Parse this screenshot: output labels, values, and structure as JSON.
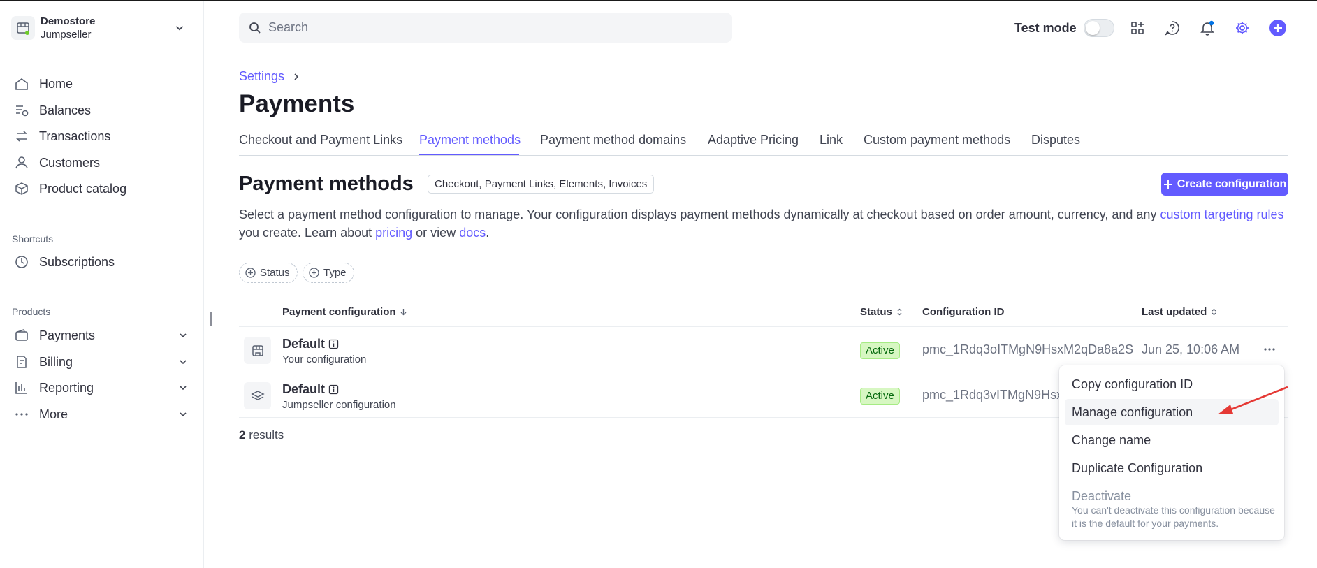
{
  "account": {
    "name": "Demostore",
    "sub": "Jumpseller"
  },
  "nav": {
    "main": [
      "Home",
      "Balances",
      "Transactions",
      "Customers",
      "Product catalog"
    ],
    "shortcuts_label": "Shortcuts",
    "shortcuts": [
      "Subscriptions"
    ],
    "products_label": "Products",
    "products": [
      "Payments",
      "Billing",
      "Reporting",
      "More"
    ]
  },
  "search": {
    "placeholder": "Search"
  },
  "topbar": {
    "test_mode_label": "Test mode",
    "test_mode_on": false
  },
  "breadcrumb": "Settings",
  "page_title": "Payments",
  "tabs": [
    "Checkout and Payment Links",
    "Payment methods",
    "Payment method domains",
    "Adaptive Pricing",
    "Link",
    "Custom payment methods",
    "Disputes"
  ],
  "active_tab": "Payment methods",
  "section": {
    "title": "Payment methods",
    "tag": "Checkout, Payment Links, Elements, Invoices",
    "create_button": "Create configuration",
    "desc_1": "Select a payment method configuration to manage. Your configuration displays payment methods dynamically at checkout based on order amount, currency, and any ",
    "desc_link_1": "custom targeting rules",
    "desc_2": " you create. Learn about ",
    "desc_link_2": "pricing",
    "desc_3": " or view ",
    "desc_link_3": "docs",
    "desc_4": "."
  },
  "filters": [
    "Status",
    "Type"
  ],
  "table": {
    "headers": [
      "Payment configuration",
      "Status",
      "Configuration ID",
      "Last updated"
    ],
    "rows": [
      {
        "name": "Default",
        "sub": "Your configuration",
        "status": "Active",
        "id": "pmc_1Rdq3oITMgN9HsxM2qDa8a2S",
        "updated": "Jun 25, 10:06 AM"
      },
      {
        "name": "Default",
        "sub": "Jumpseller configuration",
        "status": "Active",
        "id": "pmc_1Rdq3vITMgN9HsxM",
        "updated": ""
      }
    ]
  },
  "results": {
    "count": "2",
    "label": " results"
  },
  "menu": {
    "items": [
      "Copy configuration ID",
      "Manage configuration",
      "Change name",
      "Duplicate Configuration",
      "Deactivate"
    ],
    "note": "You can't deactivate this configuration because it is the default for your payments."
  },
  "colors": {
    "accent": "#635bff",
    "annotation_arrow": "#e53935"
  }
}
